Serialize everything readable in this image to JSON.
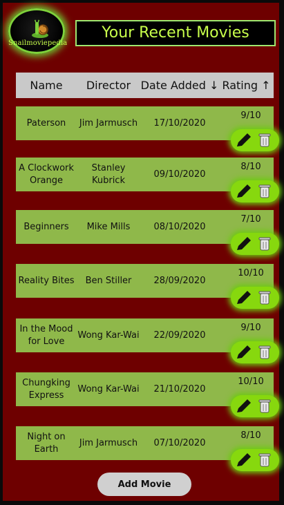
{
  "brand": {
    "logo_text": "Snailmoviepedia"
  },
  "page": {
    "title": "Your Recent Movies"
  },
  "table": {
    "headers": {
      "name": "Name",
      "director": "Director",
      "date": "Date Added ↓",
      "rating": "Rating ↑"
    },
    "rows": [
      {
        "name": "Paterson",
        "director": "Jim Jarmusch",
        "date": "17/10/2020",
        "rating": "9/10"
      },
      {
        "name": "A Clockwork Orange",
        "director": "Stanley Kubrick",
        "date": "09/10/2020",
        "rating": "8/10"
      },
      {
        "name": "Beginners",
        "director": "Mike Mills",
        "date": "08/10/2020",
        "rating": "7/10"
      },
      {
        "name": "Reality Bites",
        "director": "Ben Stiller",
        "date": "28/09/2020",
        "rating": "10/10"
      },
      {
        "name": "In the Mood for Love",
        "director": "Wong Kar-Wai",
        "date": "22/09/2020",
        "rating": "9/10"
      },
      {
        "name": "Chungking Express",
        "director": "Wong Kar-Wai",
        "date": "21/10/2020",
        "rating": "10/10"
      },
      {
        "name": "Night on Earth",
        "director": "Jim Jarmusch",
        "date": "07/10/2020",
        "rating": "8/10"
      }
    ]
  },
  "actions": {
    "add_movie_label": "Add Movie"
  },
  "icons": {
    "edit": "pencil-icon",
    "delete": "trash-icon"
  },
  "colors": {
    "background": "#6e0000",
    "row": "#8fb84a",
    "accent": "#87d80e",
    "header": "#c9c9c9",
    "title_text": "#c8ff4b"
  }
}
